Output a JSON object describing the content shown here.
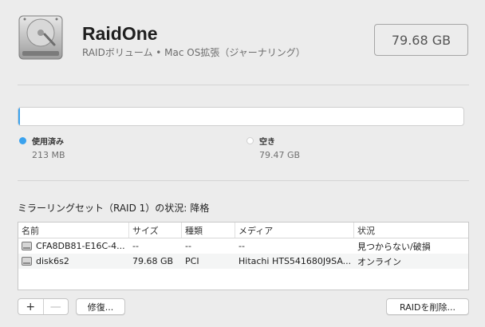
{
  "volume": {
    "name": "RaidOne",
    "subtitle": "RAIDボリューム • Mac OS拡張（ジャーナリング）",
    "capacity": "79.68 GB"
  },
  "usage": {
    "used_fraction": 0.0027,
    "used_label": "使用済み",
    "used_value": "213 MB",
    "free_label": "空き",
    "free_value": "79.47 GB",
    "used_color": "#3aa2ee"
  },
  "mirror": {
    "status_label": "ミラーリングセット（RAID 1）の状況:",
    "status_value": "降格"
  },
  "table": {
    "headers": [
      "名前",
      "サイズ",
      "種類",
      "メディア",
      "状況"
    ],
    "rows": [
      [
        "CFA8DB81-E16C-4...",
        "--",
        "--",
        "--",
        "見つからない/破損"
      ],
      [
        "disk6s2",
        "79.68 GB",
        "PCI",
        "Hitachi HTS541680J9SA...",
        "オンライン"
      ]
    ]
  },
  "buttons": {
    "add": "+",
    "remove": "—",
    "repair": "修復...",
    "delete_raid": "RAIDを削除..."
  },
  "icons": {
    "volume": "hard-drive-icon",
    "row": "disk-icon"
  }
}
